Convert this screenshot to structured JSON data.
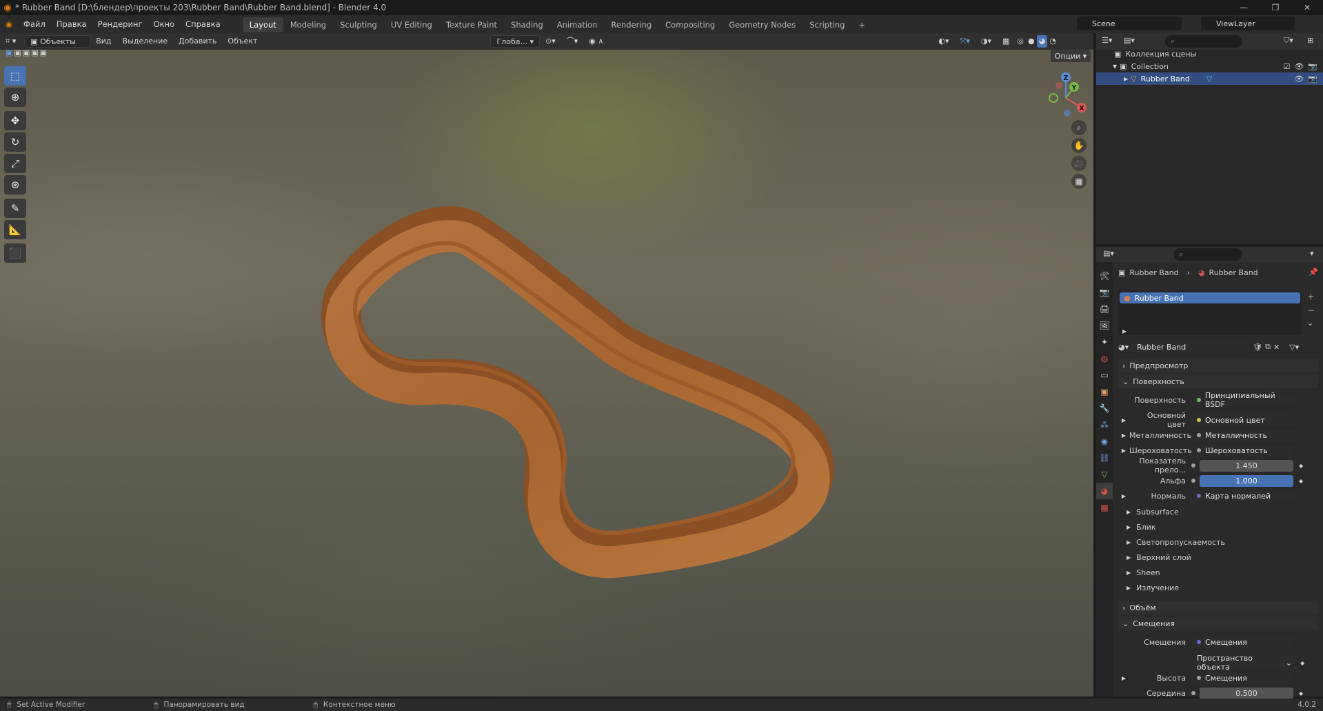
{
  "window": {
    "title": "* Rubber Band [D:\\блендер\\проекты 203\\Rubber Band\\Rubber Band.blend] - Blender 4.0",
    "controls": [
      "—",
      "❐",
      "✕"
    ]
  },
  "menu": [
    "Файл",
    "Правка",
    "Рендеринг",
    "Окно",
    "Справка"
  ],
  "workspaces": [
    {
      "label": "Layout",
      "active": true
    },
    {
      "label": "Modeling"
    },
    {
      "label": "Sculpting"
    },
    {
      "label": "UV Editing"
    },
    {
      "label": "Texture Paint"
    },
    {
      "label": "Shading"
    },
    {
      "label": "Animation"
    },
    {
      "label": "Rendering"
    },
    {
      "label": "Compositing"
    },
    {
      "label": "Geometry Nodes"
    },
    {
      "label": "Scripting"
    }
  ],
  "add_workspace": "+",
  "scene": "Scene",
  "view_layer": "ViewLayer",
  "viewport_header": {
    "mode": "Объекты",
    "menus": [
      "Вид",
      "Выделение",
      "Добавить",
      "Объект"
    ],
    "transform_orientation": "Глоба...",
    "options": "Опции"
  },
  "gizmo": {
    "z": "Z",
    "y": "Y",
    "x": "X"
  },
  "outliner": {
    "scene_collection": "Коллекция сцены",
    "collection": "Collection",
    "object": "Rubber Band"
  },
  "properties": {
    "breadcrumb_object": "Rubber Band",
    "breadcrumb_material": "Rubber Band",
    "slot": "Rubber Band",
    "material_name": "Rubber Band",
    "sections": {
      "preview": "Предпросмотр",
      "surface": "Поверхность",
      "volume": "Объём",
      "displacement": "Смещения"
    },
    "surface_rows": [
      {
        "label": "Поверхность",
        "value": "Принципиальный BSDF"
      },
      {
        "label": "Основной цвет",
        "value": "Основной цвет"
      },
      {
        "label": "Металличность",
        "value": "Металличность"
      },
      {
        "label": "Шероховатость",
        "value": "Шероховатость"
      },
      {
        "label": "Показатель прело...",
        "value": "1.450"
      },
      {
        "label": "Альфа",
        "value": "1.000"
      },
      {
        "label": "Нормаль",
        "value": "Карта нормалей"
      }
    ],
    "subpanels": [
      "Subsurface",
      "Блик",
      "Светопропускаемость",
      "Верхний слой",
      "Sheen",
      "Излучение"
    ],
    "disp_rows": [
      {
        "label": "Смещения",
        "value": "Смещения"
      },
      {
        "label": "",
        "value": "Пространство объекта"
      },
      {
        "label": "Высота",
        "value": "Смещения"
      },
      {
        "label": "Середина",
        "value": "0.500"
      }
    ]
  },
  "statusbar": {
    "left": "Set Active Modifier",
    "middle": "Панорамировать вид",
    "right": "Контекстное меню",
    "version": "4.0.2"
  },
  "colors": {
    "accent": "#4772b3",
    "selection": "#334d80",
    "rubber": "#b26a35",
    "logo": "#e87d0d"
  }
}
